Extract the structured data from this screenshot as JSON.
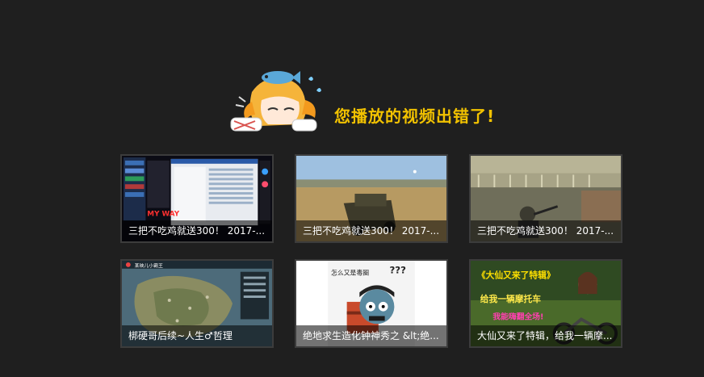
{
  "error": {
    "message": "您播放的视频出错了!"
  },
  "colors": {
    "background": "#1f1f1f",
    "accent": "#f2c200",
    "card_border": "#3c3c3c"
  },
  "recommendations": [
    {
      "title": "三把不吃鸡就送300！ 2017-..."
    },
    {
      "title": "三把不吃鸡就送300！ 2017-..."
    },
    {
      "title": "三把不吃鸡就送300！ 2017-..."
    },
    {
      "title": "梆硬哥后续~人生♂哲理"
    },
    {
      "title": "绝地求生造化钟神秀之  &lt;绝..."
    },
    {
      "title": "大仙又来了特辑，给我一辆摩..."
    }
  ],
  "thumb_text": {
    "t4_header": "某映儿小霸王",
    "t5_speech": "怎么又是毒圈",
    "t5_bubble": "???",
    "t6_banner": "《大仙又来了特辑》",
    "t6_line2": "给我一辆摩托车",
    "t6_line3": "我能嗨翻全场!"
  }
}
